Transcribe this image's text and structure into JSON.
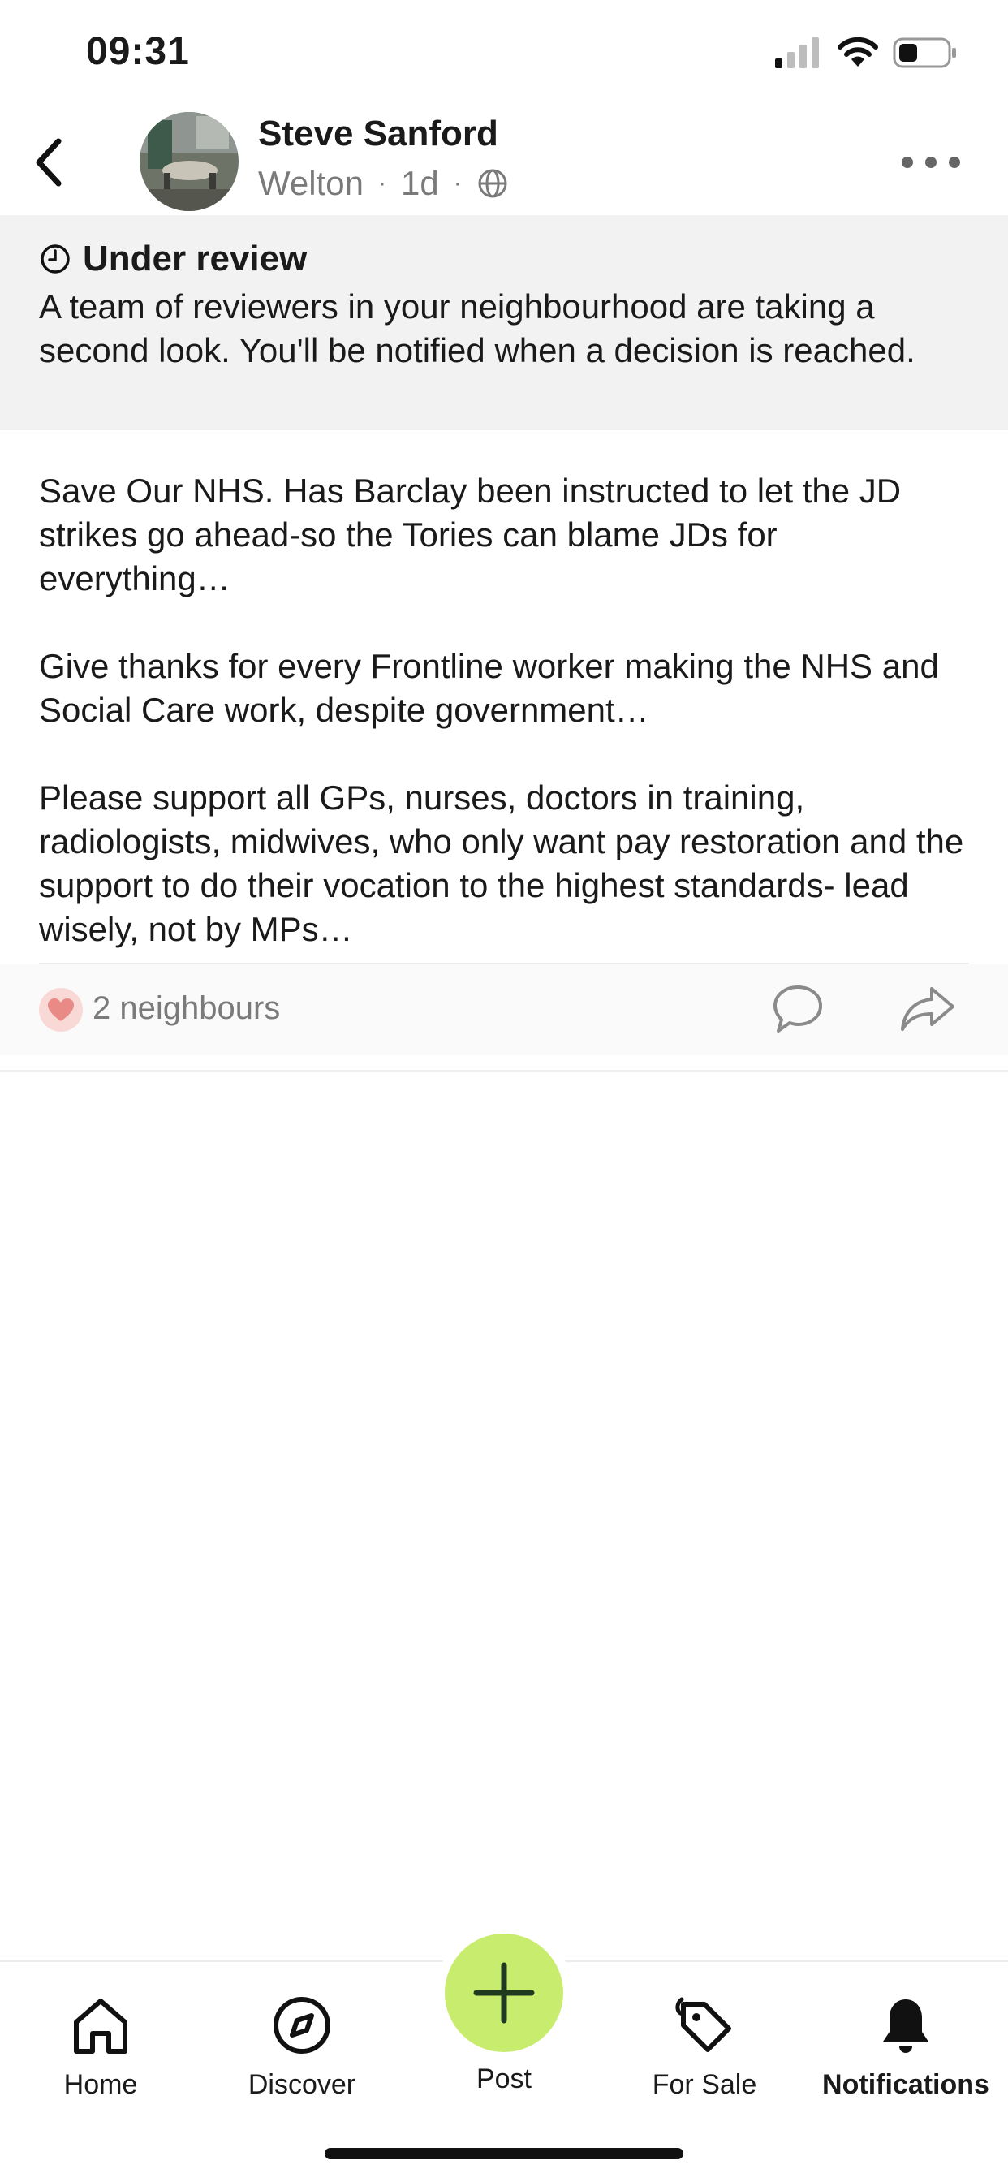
{
  "status_bar": {
    "time": "09:31",
    "icons": [
      "cellular-signal-icon",
      "wifi-icon",
      "battery-icon"
    ]
  },
  "header": {
    "back_icon": "chevron-left-icon",
    "author_name": "Steve Sanford",
    "location": "Welton",
    "separator": "·",
    "age": "1d",
    "visibility_icon": "globe-icon",
    "more_icon": "more-horizontal-icon"
  },
  "review_banner": {
    "icon": "clock-icon",
    "title": "Under review",
    "text": "A team of reviewers in your neighbourhood are taking a second look. You'll be notified when a decision is reached."
  },
  "post": {
    "paragraphs": [
      "Save Our NHS. Has Barclay been instructed to let the JD strikes go ahead-so the Tories can blame JDs for everything…",
      "Give thanks for every Frontline worker making the NHS and Social Care work, despite government…",
      "Please support all GPs, nurses, doctors in training, radiologists, midwives, who only want pay restoration and the support to do their vocation to the highest standards- lead wisely, not by MPs…"
    ]
  },
  "reactions": {
    "icon": "heart-icon",
    "count_label": "2 neighbours",
    "comment_icon": "comment-icon",
    "share_icon": "share-icon"
  },
  "tab_bar": {
    "home": "Home",
    "discover": "Discover",
    "post": "Post",
    "for_sale": "For Sale",
    "notifications": "Notifications",
    "active_tab": "Notifications"
  },
  "colors": {
    "accent_fab": "#c8ec6e",
    "banner_bg": "#f2f2f2",
    "heart_bg": "#f9d9d6",
    "heart": "#e98a86",
    "muted_text": "#7a7a7a"
  }
}
